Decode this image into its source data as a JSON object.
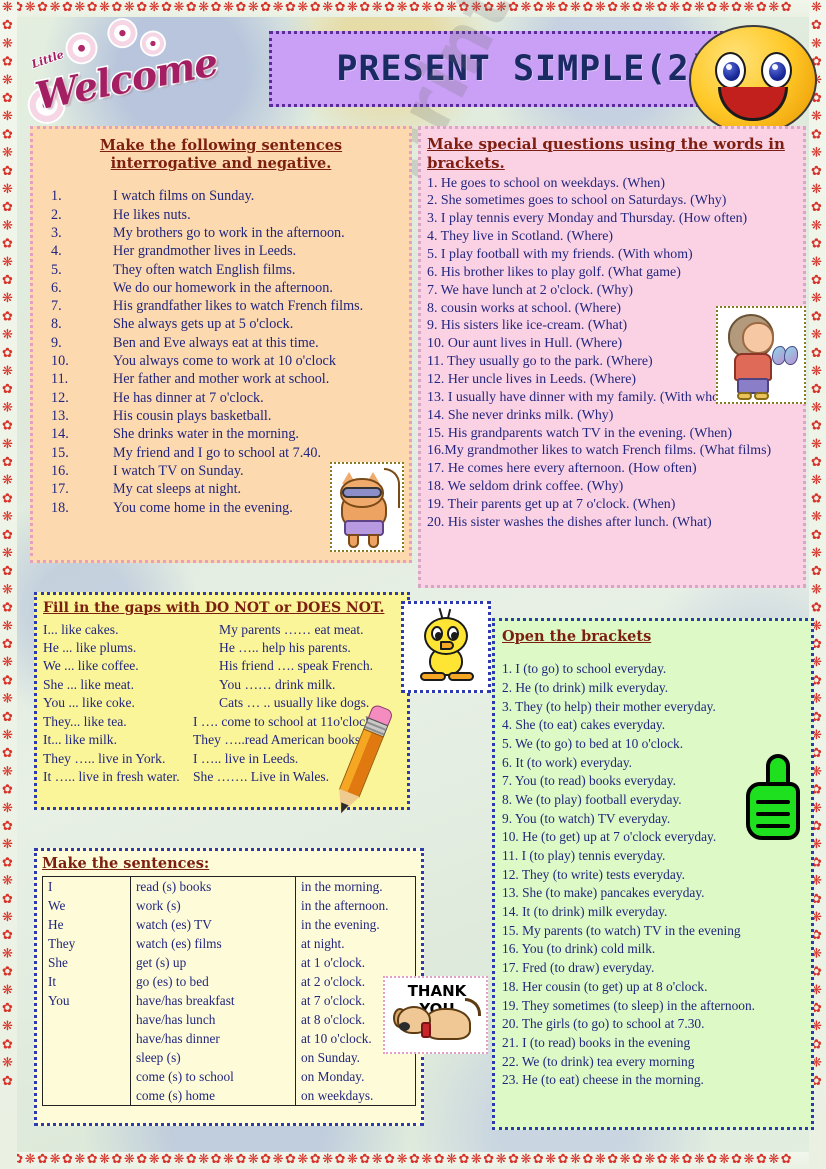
{
  "header": {
    "welcome_small": "Little",
    "welcome": "Welcome",
    "title": "PRESENT  SIMPLE(2)",
    "smiley_icon": "smiley-face"
  },
  "watermark": "eslprintables.com",
  "interrogative": {
    "title": "Make the following sentences interrogative and negative.",
    "items": [
      {
        "num": "1.",
        "text": "I watch films on Sunday."
      },
      {
        "num": "2.",
        "text": "He likes nuts."
      },
      {
        "num": "3.",
        "text": "My brothers go to work in the afternoon."
      },
      {
        "num": "4.",
        "text": "Her grandmother lives in Leeds."
      },
      {
        "num": "5.",
        "text": "They often watch English films."
      },
      {
        "num": "6.",
        "text": "We do our homework in the afternoon."
      },
      {
        "num": "7.",
        "text": "His grandfather likes to watch French films."
      },
      {
        "num": "8.",
        "text": "She always gets up at 5 o'clock."
      },
      {
        "num": "9.",
        "text": "Ben and Eve always eat at this time."
      },
      {
        "num": "10.",
        "text": "You always come to work at 10 o'clock"
      },
      {
        "num": "11.",
        "text": "Her father and mother work at school."
      },
      {
        "num": "12.",
        "text": "He has dinner at 7 o'clock."
      },
      {
        "num": "13.",
        "text": "His cousin plays basketball."
      },
      {
        "num": "14.",
        "text": "She drinks water in the morning."
      },
      {
        "num": "15.",
        "text": "My friend and I go to school at 7.40."
      },
      {
        "num": "16.",
        "text": "I watch TV on Sunday."
      },
      {
        "num": "17.",
        "text": "My cat sleeps at night."
      },
      {
        "num": "18.",
        "text": "You come home in the evening."
      }
    ]
  },
  "special_questions": {
    "title": "Make special questions using the words in brackets.",
    "items": [
      "1. He goes to school on weekdays. (When)",
      "2. She sometimes goes to school on Saturdays. (Why)",
      "3. I play tennis every Monday and Thursday. (How often)",
      "4. They live in Scotland. (Where)",
      "5. I play football with my friends. (With whom)",
      "6. His brother likes to play golf. (What game)",
      "7. We have lunch at 2 o'clock. (Why)",
      "8. cousin works at school. (Where)",
      "9. His sisters like ice-cream. (What)",
      "10. Our aunt lives in Hull. (Where)",
      "11. They usually go to the park. (Where)",
      "12. Her uncle lives in Leeds. (Where)",
      "13. I usually have dinner with my family. (With whom)",
      "14. She never drinks milk. (Why)",
      "15. His grandparents watch TV in the evening. (When)",
      "16.My grandmother likes to watch French films. (What films)",
      "17. He comes here every afternoon. (How often)",
      "18. We seldom drink coffee. (Why)",
      "19. Their parents get up at 7 o'clock. (When)",
      "20. His sister washes the dishes after lunch. (What)"
    ]
  },
  "do_not": {
    "title": "Fill in the gaps with DO NOT or DOES NOT.",
    "rows": [
      {
        "left": "I... like cakes.",
        "right": "My parents …… eat meat."
      },
      {
        "left": "He ... like plums.",
        "right": "He ….. help his parents."
      },
      {
        "left": "We ... like coffee.",
        "right": "His friend …. speak French."
      },
      {
        "left": "She ... like meat.",
        "right": "You …… drink milk."
      },
      {
        "left": "You ... like coke.",
        "right": "Cats … .. usually like dogs."
      },
      {
        "left": "They... like tea.",
        "right": "I …. come to school at 11o'clock."
      },
      {
        "left": "It... like milk.",
        "right": "They …..read American books."
      },
      {
        "left": "They ….. live in York.",
        "right": "I ….. live in Leeds."
      },
      {
        "left": "It ….. live in fresh water.",
        "right": "She ……. Live in Wales."
      }
    ]
  },
  "open_brackets": {
    "title": "Open the brackets",
    "items": [
      "1. I (to go) to school everyday.",
      "2. He (to drink) milk everyday.",
      "3. They (to help) their mother everyday.",
      "4. She (to eat) cakes everyday.",
      "5. We (to go) to bed at 10 o'clock.",
      "6. It (to work) everyday.",
      "7. You (to read) books everyday.",
      "8. We (to play) football everyday.",
      "9. You (to watch) TV everyday.",
      "10. He (to get) up at 7 o'clock everyday.",
      "11. I (to play) tennis everyday.",
      "12. They (to write) tests everyday.",
      "13. She (to make) pancakes everyday.",
      "14. It (to drink) milk everyday.",
      "15. My parents (to watch) TV in the evening",
      "16. You (to drink) cold milk.",
      "17. Fred (to draw) everyday.",
      "18. Her cousin (to get) up at 8 o'clock.",
      "19. They sometimes (to sleep) in the afternoon.",
      "20. The girls (to go) to school at 7.30.",
      "21. I (to read) books in the evening",
      "22. We (to drink) tea every morning",
      "23. He (to eat) cheese in the morning."
    ]
  },
  "make_sentences": {
    "title": "Make the sentences:",
    "column1": [
      "I",
      "We",
      "He",
      "They",
      "She",
      "It",
      "You"
    ],
    "column2": [
      "read (s) books",
      "work (s)",
      "watch (es) TV",
      "watch (es) films",
      "get (s) up",
      "go (es) to bed",
      "have/has breakfast",
      "have/has lunch",
      "have/has dinner",
      "sleep (s)",
      "come (s) to school",
      "come (s) home"
    ],
    "column3": [
      "in the morning.",
      "in the afternoon.",
      "in the evening.",
      "at night.",
      "at 1 o'clock.",
      "at 2 o'clock.",
      "at 7 o'clock.",
      "at 8 o'clock.",
      "at 10 o'clock.",
      "on Sunday.",
      "on Monday.",
      "on weekdays."
    ]
  },
  "clipart": {
    "cat": "cat-with-sunglasses",
    "girl": "girl-with-butterfly",
    "tweety": "tweety-bird",
    "pencil": "pencil",
    "thumb": "thumbs-up-hand",
    "thanks_text": "THANK YOU",
    "thanks_dog": "dog"
  },
  "colors": {
    "title_banner": "#c9a0f5",
    "title_text": "#1a2a63",
    "box_orange": "#fcd9ae",
    "box_pink": "#fbd2e4",
    "box_yellow": "#fbf59a",
    "box_green": "#ddf9c5",
    "box_cream": "#fdfbd8",
    "heading_red": "#7d1f10",
    "sentence_blue": "#22267e",
    "border_flower": "#d8332a"
  }
}
